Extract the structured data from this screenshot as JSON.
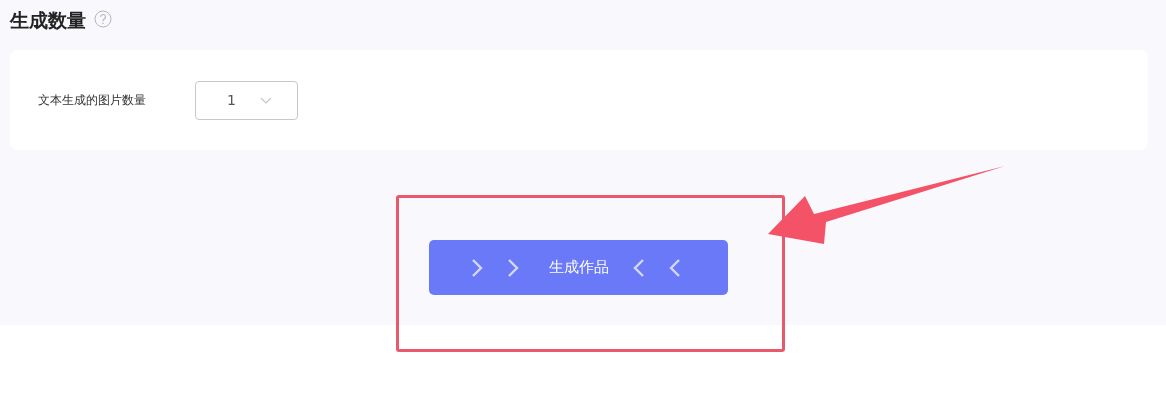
{
  "section": {
    "title": "生成数量"
  },
  "setting": {
    "label": "文本生成的图片数量",
    "value": "1"
  },
  "generate_button": {
    "label": "生成作品"
  }
}
